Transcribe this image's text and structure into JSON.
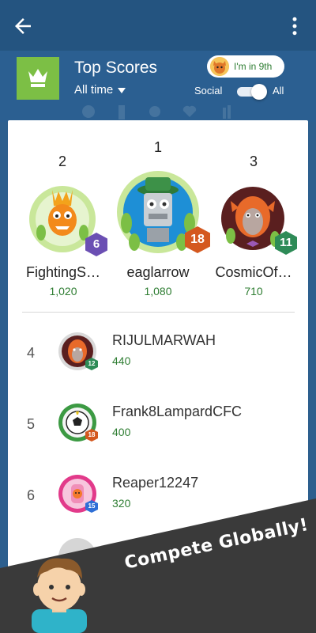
{
  "header": {
    "title": "Top Scores",
    "period": "All time",
    "my_rank": "I'm in 9th",
    "toggle_left": "Social",
    "toggle_right": "All"
  },
  "podium": [
    {
      "place": "2",
      "name": "FightingS…",
      "score": "1,020",
      "level": "6",
      "badge_color": "#6b4fb3"
    },
    {
      "place": "1",
      "name": "eaglarrow",
      "score": "1,080",
      "level": "18",
      "badge_color": "#d4581f"
    },
    {
      "place": "3",
      "name": "CosmicOf…",
      "score": "710",
      "level": "11",
      "badge_color": "#2e8b57"
    }
  ],
  "list": [
    {
      "rank": "4",
      "name": "RIJULMARWAH",
      "score": "440",
      "level": "12",
      "badge_color": "#2e8b57"
    },
    {
      "rank": "5",
      "name": "Frank8LampardCFC",
      "score": "400",
      "level": "18",
      "badge_color": "#d4581f"
    },
    {
      "rank": "6",
      "name": "Reaper12247",
      "score": "320",
      "level": "15",
      "badge_color": "#2f6fd6"
    }
  ],
  "promo": {
    "text": "Compete Globally!"
  },
  "colors": {
    "appbar": "#245480",
    "header": "#2b5f91",
    "crown_box": "#7cbf45",
    "score_green": "#2e7d32",
    "promo_band": "#3a3a3a"
  }
}
